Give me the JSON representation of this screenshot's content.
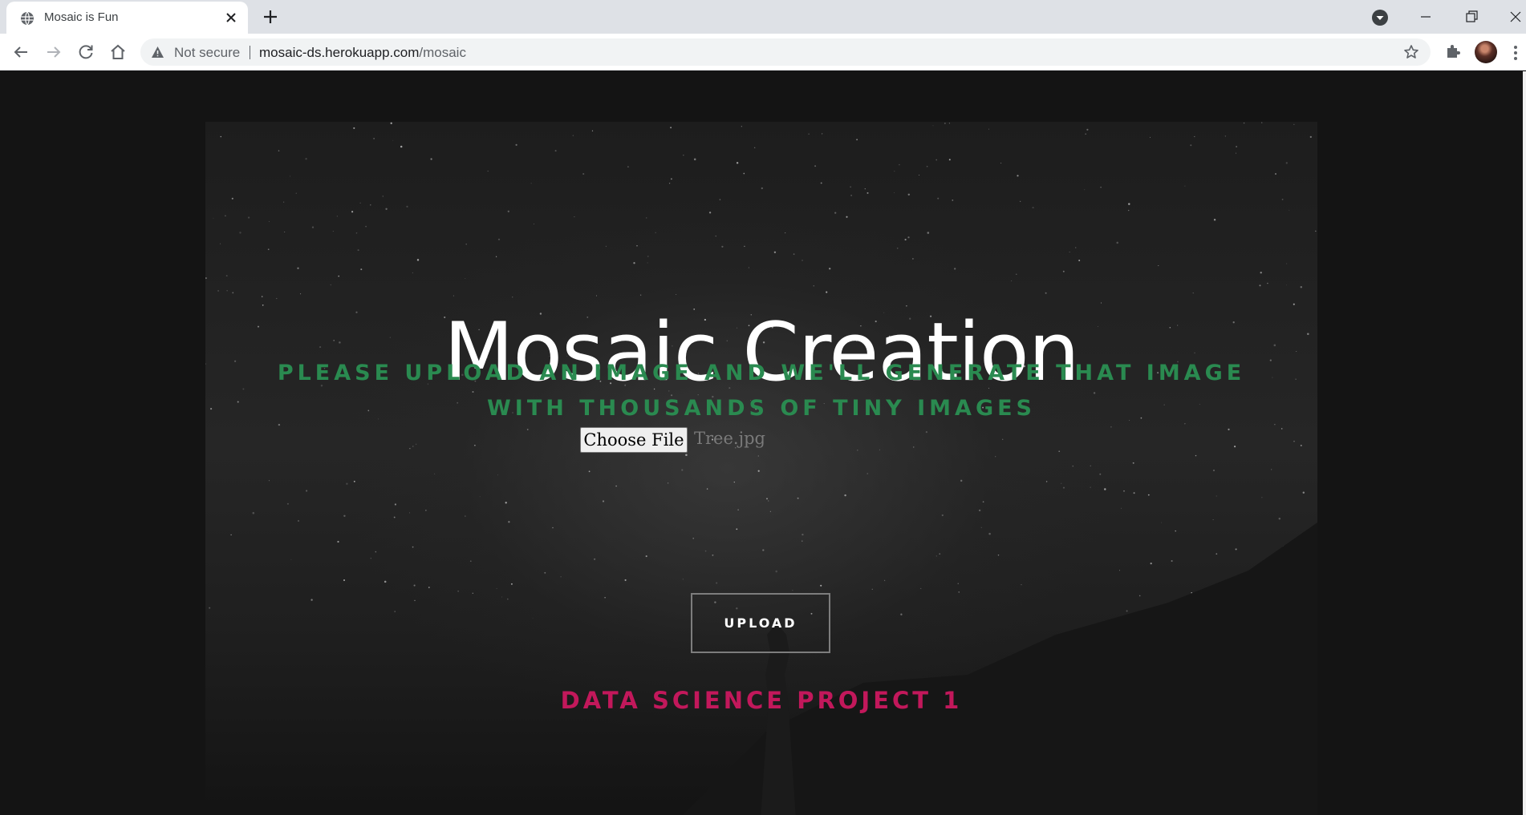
{
  "browser": {
    "tab": {
      "title": "Mosaic is Fun"
    },
    "address_bar": {
      "security_label": "Not secure",
      "url_host": "mosaic-ds.herokuapp.com",
      "url_path": "/mosaic"
    }
  },
  "page": {
    "title": "Mosaic Creation",
    "subtitle": "PLEASE UPLOAD AN IMAGE AND WE'LL GENERATE THAT IMAGE WITH THOUSANDS OF TINY IMAGES",
    "file_input": {
      "button_label": "Choose File",
      "selected_file": "Tree.jpg"
    },
    "upload_button": "UPLOAD",
    "footer": "DATA SCIENCE PROJECT 1"
  },
  "colors": {
    "subtitle": "#2a8a50",
    "footer": "#c2185b",
    "background": "#141414"
  },
  "icons": [
    "globe-icon",
    "close-icon",
    "plus-icon",
    "tab-search-icon",
    "minimize-icon",
    "maximize-icon",
    "window-close-icon",
    "back-arrow-icon",
    "forward-arrow-icon",
    "reload-icon",
    "home-icon",
    "warning-icon",
    "star-icon",
    "puzzle-icon",
    "kebab-menu-icon"
  ]
}
